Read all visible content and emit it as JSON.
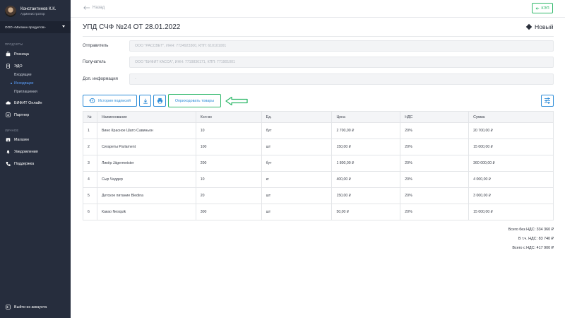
{
  "user": {
    "name": "Константинов К.К.",
    "role": "Администратор"
  },
  "org": {
    "name": "ООО «Магазин продуктов»"
  },
  "sidebar": {
    "section_products": "ПРОДУКТЫ",
    "retail": "Розница",
    "edo": "ЭДО",
    "incoming": "Входящие",
    "outgoing": "Исходящие",
    "invitations": "Приглашения",
    "bifit_online": "БИФИТ Онлайн",
    "partner": "Партнер",
    "section_personal": "ЛИЧНОЕ",
    "shops": "Магазин",
    "notifications": "Уведомления",
    "support": "Поддержка",
    "logout": "Выйти из аккаунта"
  },
  "header": {
    "back_label": "Назад",
    "kep_label": "КЭП"
  },
  "document": {
    "title": "УПД СЧФ №24 ОТ 28.01.2022",
    "status": "Новый"
  },
  "fields": {
    "sender_label": "Отправитель",
    "sender_value": "ООО \"РАССВЕТ\", ИНН: 7724923300, КПП: 610101001",
    "recipient_label": "Получатель",
    "recipient_value": "ООО \"БИФИТ КАССА\", ИНН: 7719836171, КПП: 771901001",
    "extra_label": "Доп. информация",
    "extra_value": "-"
  },
  "actions": {
    "history_label": "История подписей",
    "receive_label": "Оприходовать товары"
  },
  "table": {
    "headers": [
      "№",
      "Наименование",
      "Кол-во",
      "Ед.",
      "Цена",
      "НДС",
      "Сумма"
    ],
    "rows": [
      [
        "1",
        "Вино Красное Шато Савиньон",
        "10",
        "бут",
        "2 700,00 ₽",
        "20%",
        "20 700,00 ₽"
      ],
      [
        "2",
        "Сигареты Parlament",
        "100",
        "шт",
        "150,00 ₽",
        "20%",
        "15 000,00 ₽"
      ],
      [
        "3",
        "Ликёр Jägermeister",
        "200",
        "бут",
        "1 800,00 ₽",
        "20%",
        "360 000,00 ₽"
      ],
      [
        "4",
        "Сыр Чеддер",
        "10",
        "кг",
        "400,00 ₽",
        "20%",
        "4 000,00 ₽"
      ],
      [
        "5",
        "Детское питание Bledina",
        "20",
        "шт",
        "150,00 ₽",
        "20%",
        "3 000,00 ₽"
      ],
      [
        "6",
        "Какао Nesquik",
        "300",
        "шт",
        "50,00 ₽",
        "20%",
        "15 000,00 ₽"
      ]
    ]
  },
  "totals": {
    "without_vat": "Всего без НДС: 334 360 ₽",
    "vat": "В т.ч. НДС: 83 740 ₽",
    "with_vat": "Всего с НДС: 417 900 ₽"
  },
  "colors": {
    "sidebar_bg": "#262d3d",
    "accent_blue": "#2f8dd8",
    "accent_green": "#2fb86a"
  }
}
